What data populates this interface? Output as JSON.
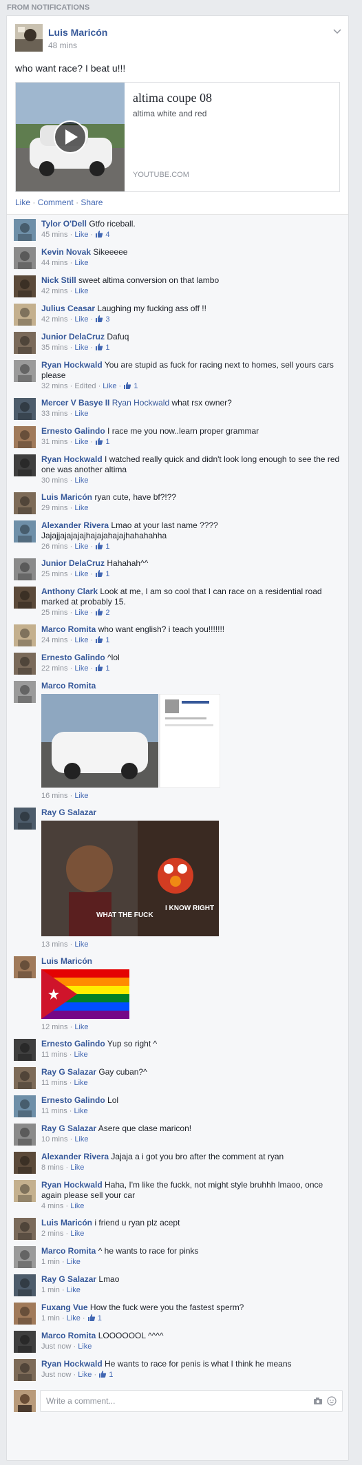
{
  "header": {
    "label": "FROM NOTIFICATIONS"
  },
  "post": {
    "author": "Luis Maricón",
    "time": "48 mins",
    "text": "who want race? I beat u!!!",
    "link": {
      "title": "altima coupe 08",
      "description": "altima white and red",
      "domain": "YOUTUBE.COM"
    },
    "actions": {
      "like": "Like",
      "comment": "Comment",
      "share": "Share",
      "sep": "·"
    }
  },
  "comments": [
    {
      "author": "Tylor O'Dell",
      "text": "Gtfo riceball.",
      "time": "45 mins",
      "likes": "4"
    },
    {
      "author": "Kevin Novak",
      "text": "Sikeeeee",
      "time": "44 mins",
      "likes": ""
    },
    {
      "author": "Nick Still",
      "text": "sweet altima conversion on that lambo",
      "time": "42 mins",
      "likes": ""
    },
    {
      "author": "Julius Ceasar",
      "text": "Laughing my fucking ass off !!",
      "time": "42 mins",
      "likes": "3"
    },
    {
      "author": "Junior DelaCruz",
      "text": "Dafuq",
      "time": "35 mins",
      "likes": "1"
    },
    {
      "author": "Ryan Hockwald",
      "text": "You are stupid as fuck for racing next to homes, sell yours cars please",
      "time": "32 mins",
      "edited": "Edited",
      "likes": "1"
    },
    {
      "author": "Mercer V Basye II",
      "mention": "Ryan Hockwald",
      "text": "what rsx owner?",
      "time": "33 mins",
      "likes": ""
    },
    {
      "author": "Ernesto Galindo",
      "text": "I race me you now..learn proper grammar",
      "time": "31 mins",
      "likes": "1"
    },
    {
      "author": "Ryan Hockwald",
      "text": "I watched really quick and didn't look long enough to see the red one was another altima",
      "time": "30 mins",
      "likes": ""
    },
    {
      "author": "Luis Maricón",
      "text": "ryan cute, have bf?!??",
      "time": "29 mins",
      "likes": ""
    },
    {
      "author": "Alexander Rivera",
      "text": "Lmao at your last name ???? Jajajjajajajajhajajahajajhahahahha",
      "time": "26 mins",
      "likes": "1"
    },
    {
      "author": "Junior DelaCruz",
      "text": "Hahahah^^",
      "time": "25 mins",
      "likes": "1"
    },
    {
      "author": "Anthony Clark",
      "text": "Look at me, I am so cool that I can race on a residential road marked at probably 15.",
      "time": "25 mins",
      "likes": "2"
    },
    {
      "author": "Marco Romita",
      "text": "who want english? i teach you!!!!!!!",
      "time": "24 mins",
      "likes": "1"
    },
    {
      "author": "Ernesto Galindo",
      "text": "^lol",
      "time": "22 mins",
      "likes": "1"
    },
    {
      "author": "Marco Romita",
      "text": "",
      "time": "16 mins",
      "likes": "",
      "attachment": "screenshot"
    },
    {
      "author": "Ray G Salazar",
      "text": "",
      "time": "13 mins",
      "likes": "",
      "attachment": "meme",
      "meme_left": "WHAT THE FUCK",
      "meme_right": "I KNOW RIGHT"
    },
    {
      "author": "Luis Maricón",
      "text": "",
      "time": "12 mins",
      "likes": "",
      "attachment": "flag"
    },
    {
      "author": "Ernesto Galindo",
      "text": "Yup so right ^",
      "time": "11 mins",
      "likes": ""
    },
    {
      "author": "Ray G Salazar",
      "text": "Gay cuban?^",
      "time": "11 mins",
      "likes": ""
    },
    {
      "author": "Ernesto Galindo",
      "text": "Lol",
      "time": "11 mins",
      "likes": ""
    },
    {
      "author": "Ray G Salazar",
      "text": "Asere que clase maricon!",
      "time": "10 mins",
      "likes": ""
    },
    {
      "author": "Alexander Rivera",
      "text": "Jajaja a i got you bro after the comment at ryan",
      "time": "8 mins",
      "likes": ""
    },
    {
      "author": "Ryan Hockwald",
      "text": "Haha, I'm like the fuckk, not might style bruhhh lmaoo, once again please sell your car",
      "time": "4 mins",
      "likes": ""
    },
    {
      "author": "Luis Maricón",
      "text": "i friend u ryan plz acept",
      "time": "2 mins",
      "likes": ""
    },
    {
      "author": "Marco Romita",
      "text": "^ he wants to race for pinks",
      "time": "1 min",
      "likes": ""
    },
    {
      "author": "Ray G Salazar",
      "text": "Lmao",
      "time": "1 min",
      "likes": ""
    },
    {
      "author": "Fuxang Vue",
      "text": "How the fuck were you the fastest sperm?",
      "time": "1 min",
      "likes": "1"
    },
    {
      "author": "Marco Romita",
      "text": "LOOOOOOL ^^^^",
      "time": "Just now",
      "likes": ""
    },
    {
      "author": "Ryan Hockwald",
      "text": "He wants to race for penis is what I think he means",
      "time": "Just now",
      "likes": "1"
    }
  ],
  "like_label": "Like",
  "write": {
    "placeholder": "Write a comment..."
  },
  "colors": {
    "link": "#365899",
    "meta": "#90949c",
    "bg": "#e9ebee"
  }
}
